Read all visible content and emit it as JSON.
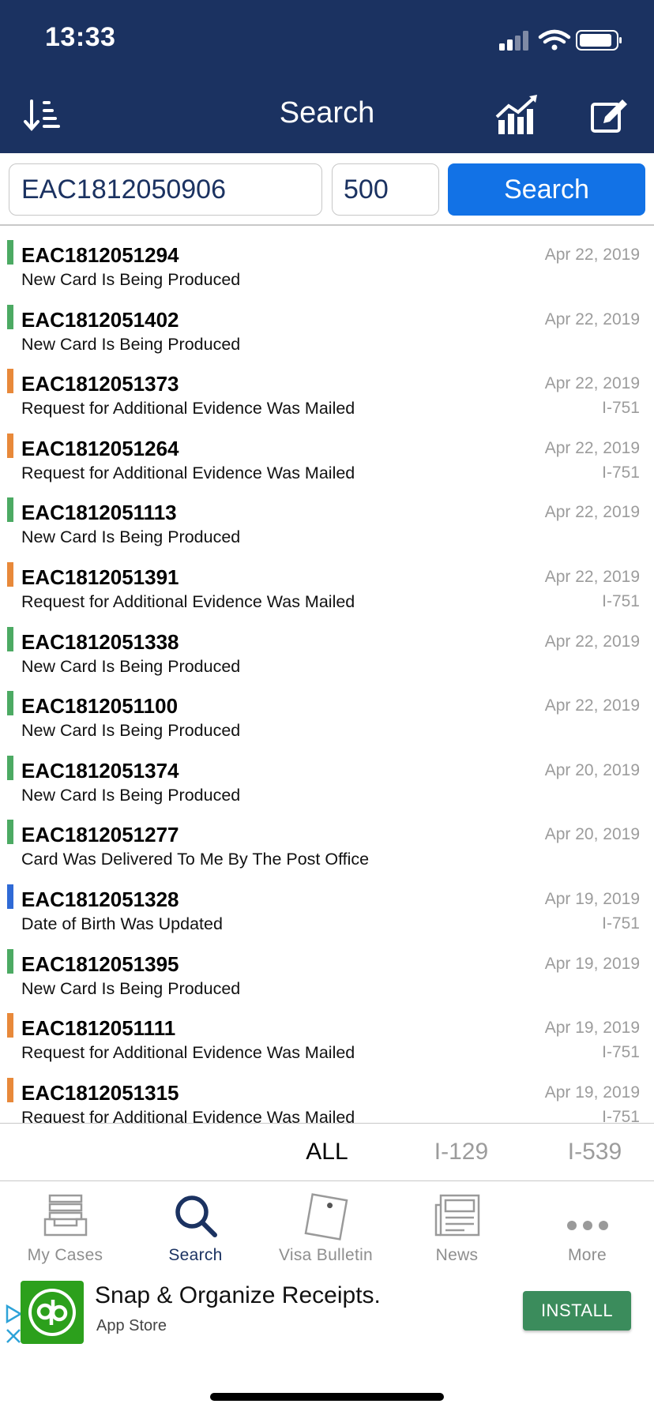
{
  "status_bar": {
    "time": "13:33"
  },
  "nav": {
    "title": "Search"
  },
  "search": {
    "query": "EAC1812050906",
    "limit": "500",
    "button_label": "Search"
  },
  "colors": {
    "navy": "#1b3261",
    "blue": "#1272e6",
    "green": "#4caa63",
    "orange": "#e8893a",
    "status_blue": "#2f6ad6"
  },
  "cases": [
    {
      "id": "EAC1812051294",
      "status": "New Card Is Being Produced",
      "date": "Apr 22, 2019",
      "form": "",
      "color": "#4caa63"
    },
    {
      "id": "EAC1812051402",
      "status": "New Card Is Being Produced",
      "date": "Apr 22, 2019",
      "form": "",
      "color": "#4caa63"
    },
    {
      "id": "EAC1812051373",
      "status": "Request for Additional Evidence Was Mailed",
      "date": "Apr 22, 2019",
      "form": "I-751",
      "color": "#e8893a"
    },
    {
      "id": "EAC1812051264",
      "status": "Request for Additional Evidence Was Mailed",
      "date": "Apr 22, 2019",
      "form": "I-751",
      "color": "#e8893a"
    },
    {
      "id": "EAC1812051113",
      "status": "New Card Is Being Produced",
      "date": "Apr 22, 2019",
      "form": "",
      "color": "#4caa63"
    },
    {
      "id": "EAC1812051391",
      "status": "Request for Additional Evidence Was Mailed",
      "date": "Apr 22, 2019",
      "form": "I-751",
      "color": "#e8893a"
    },
    {
      "id": "EAC1812051338",
      "status": "New Card Is Being Produced",
      "date": "Apr 22, 2019",
      "form": "",
      "color": "#4caa63"
    },
    {
      "id": "EAC1812051100",
      "status": "New Card Is Being Produced",
      "date": "Apr 22, 2019",
      "form": "",
      "color": "#4caa63"
    },
    {
      "id": "EAC1812051374",
      "status": "New Card Is Being Produced",
      "date": "Apr 20, 2019",
      "form": "",
      "color": "#4caa63"
    },
    {
      "id": "EAC1812051277",
      "status": "Card Was Delivered To Me By The Post Office",
      "date": "Apr 20, 2019",
      "form": "",
      "color": "#4caa63"
    },
    {
      "id": "EAC1812051328",
      "status": "Date of Birth Was Updated",
      "date": "Apr 19, 2019",
      "form": "I-751",
      "color": "#2f6ad6"
    },
    {
      "id": "EAC1812051395",
      "status": "New Card Is Being Produced",
      "date": "Apr 19, 2019",
      "form": "",
      "color": "#4caa63"
    },
    {
      "id": "EAC1812051111",
      "status": "Request for Additional Evidence Was Mailed",
      "date": "Apr 19, 2019",
      "form": "I-751",
      "color": "#e8893a"
    },
    {
      "id": "EAC1812051315",
      "status": "Request for Additional Evidence Was Mailed",
      "date": "Apr 19, 2019",
      "form": "I-751",
      "color": "#e8893a"
    }
  ],
  "filters": [
    {
      "label": "ALL",
      "active": true
    },
    {
      "label": "I-129",
      "active": false
    },
    {
      "label": "I-539",
      "active": false
    }
  ],
  "tabs": [
    {
      "label": "My Cases",
      "icon": "inbox-tray-icon",
      "active": false
    },
    {
      "label": "Search",
      "icon": "magnifier-icon",
      "active": true
    },
    {
      "label": "Visa Bulletin",
      "icon": "bulletin-note-icon",
      "active": false
    },
    {
      "label": "News",
      "icon": "newspaper-icon",
      "active": false
    },
    {
      "label": "More",
      "icon": "more-dots-icon",
      "active": false
    }
  ],
  "ad": {
    "title": "Snap & Organize Receipts.",
    "subtitle": "App Store",
    "button_label": "INSTALL"
  }
}
